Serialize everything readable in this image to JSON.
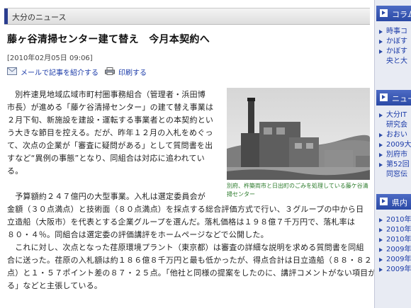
{
  "section": {
    "label": "大分のニュース"
  },
  "article": {
    "headline": "藤ヶ谷清掃センター建て替え　今月本契約へ",
    "dateline": "[2010年02月05日 09:06]",
    "tools": {
      "mail_label": "メールで記事を紹介する",
      "print_label": "印刷する"
    },
    "paragraph1": [
      "　別杵速見地域広域市町村圏事務組合（管理者・浜田博",
      "市長）が進める「藤ケ谷清掃センター」の建て替え事業は",
      "２月下旬、新施設を建設・運転する事業者との本契約とい",
      "う大きな節目を控える。だが、昨年１２月の入札をめぐっ",
      "て、次点の企業が「審査に疑問がある」として質問書を出",
      "すなど“異例の事態”となり、同組合は対応に追われてい",
      "る。"
    ],
    "paragraph2": [
      "　予算額約２４７億円の大型事業。入札は選定委員会が",
      "金額（３０点満点）と技術面（８０点満点）を採点する総合評価方式で行い、３グループの中から日",
      "立造船（大阪市）を代表とする企業グループを選んだ。落札価格は１９８億７千万円で、落札率は",
      "８０・４％。同組合は選定委の評価講評をホームページなどで公開した。",
      "　これに対し、次点となった荏原環境プラント（東京都）は審査の詳細な説明を求める質問書を同組",
      "合に送った。荏原の入札額は約１８６億８千万円と最も低かったが、得点合計は日立造船（８８・８２",
      "点）と１・５７ポイント差の８７・２５点。「他社と同様の提案をしたのに、講評コメントがない項目があ",
      "る」などと主張している。"
    ],
    "photo_caption": [
      "別府、杵築両市と日出町のごみを処理している藤ケ谷清",
      "掃センター"
    ]
  },
  "sidebar": {
    "column": {
      "title": "コラム",
      "items": [
        "時事コ",
        "かぼす",
        "かぼす",
        "央と大"
      ]
    },
    "news": {
      "title": "ニュース",
      "items": [
        "大分IT",
        "研究会",
        "おおい",
        "2009大",
        "別府市",
        "第52回",
        "同窓伝"
      ]
    },
    "kennai": {
      "title": "県内",
      "items": [
        "2010年",
        "2010年",
        "2010年",
        "2009年",
        "2009年",
        "2009年"
      ]
    }
  }
}
